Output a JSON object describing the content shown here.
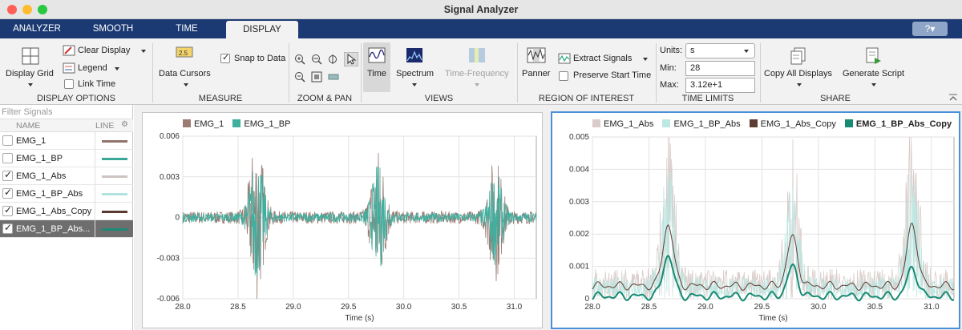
{
  "window": {
    "title": "Signal Analyzer"
  },
  "tabs": [
    {
      "label": "ANALYZER"
    },
    {
      "label": "SMOOTH"
    },
    {
      "label": "TIME"
    },
    {
      "label": "DISPLAY",
      "active": true
    }
  ],
  "help": {
    "icon": "question-icon"
  },
  "ribbon": {
    "display_options": {
      "label": "DISPLAY OPTIONS",
      "display_grid": "Display Grid",
      "clear_display": "Clear Display",
      "legend": "Legend",
      "link_time": "Link Time"
    },
    "measure": {
      "label": "MEASURE",
      "data_cursors": "Data Cursors",
      "snap_to_data": "Snap to Data",
      "cursor_icon_text": "2.5"
    },
    "zoom_pan": {
      "label": "ZOOM & PAN"
    },
    "views": {
      "label": "VIEWS",
      "time": "Time",
      "spectrum": "Spectrum",
      "time_frequency": "Time-Frequency"
    },
    "roi": {
      "label": "REGION OF INTEREST",
      "panner": "Panner",
      "extract_signals": "Extract Signals",
      "preserve_start_time": "Preserve Start Time"
    },
    "time_limits": {
      "label": "TIME LIMITS",
      "units_label": "Units:",
      "units_value": "s",
      "min_label": "Min:",
      "min_value": "28",
      "max_label": "Max:",
      "max_value": "3.12e+1"
    },
    "share": {
      "label": "SHARE",
      "copy_all_displays": "Copy All Displays",
      "generate_script": "Generate Script"
    }
  },
  "signals_table": {
    "filter_placeholder": "Filter Signals",
    "headers": {
      "name": "NAME",
      "line": "LINE"
    },
    "rows": [
      {
        "name": "EMG_1",
        "checked": false,
        "color": "#8f726c"
      },
      {
        "name": "EMG_1_BP",
        "checked": false,
        "color": "#3aa898"
      },
      {
        "name": "EMG_1_Abs",
        "checked": true,
        "color": "#cdc4c2"
      },
      {
        "name": "EMG_1_BP_Abs",
        "checked": true,
        "color": "#b3e3df"
      },
      {
        "name": "EMG_1_Abs_Copy",
        "checked": true,
        "color": "#5b3a31"
      },
      {
        "name": "EMG_1_BP_Abs...",
        "checked": true,
        "color": "#1e8a76",
        "selected": true
      }
    ]
  },
  "colors": {
    "emg1": "#9c7b74",
    "emg1_bp": "#3fb0a0",
    "abs": "#d9ccc9",
    "bp_abs": "#bde7e2",
    "abs_copy": "#5e3d35",
    "bp_abs_copy": "#178a73",
    "selected_border": "#4a90d9"
  },
  "chart_data": [
    {
      "type": "line",
      "legend": [
        "EMG_1",
        "EMG_1_BP"
      ],
      "xlabel": "Time (s)",
      "xlim": [
        28.0,
        31.2
      ],
      "ylim": [
        -0.006,
        0.006
      ],
      "xticks": [
        "28.0",
        "28.5",
        "29.0",
        "29.5",
        "30.0",
        "30.5",
        "31.0"
      ],
      "yticks": [
        "0.006",
        "0.003",
        "0",
        "-0.003",
        "-0.006"
      ],
      "bursts": [
        {
          "t": 28.67,
          "amp": 0.0058
        },
        {
          "t": 29.77,
          "amp": 0.0048
        },
        {
          "t": 30.83,
          "amp": 0.0042
        }
      ],
      "baseline_amp": 0.0004
    },
    {
      "type": "line",
      "legend": [
        "EMG_1_Abs",
        "EMG_1_BP_Abs",
        "EMG_1_Abs_Copy",
        "EMG_1_BP_Abs_Copy"
      ],
      "xlabel": "Time (s)",
      "xlim": [
        28.0,
        31.2
      ],
      "ylim": [
        0,
        0.005
      ],
      "xticks": [
        "28.0",
        "28.5",
        "29.0",
        "29.5",
        "30.0",
        "30.5",
        "31.0"
      ],
      "yticks": [
        "0.005",
        "0.004",
        "0.003",
        "0.002",
        "0.001",
        "0"
      ],
      "abs_copy_peaks": [
        {
          "t": 28.67,
          "v": 0.0023
        },
        {
          "t": 29.77,
          "v": 0.0019
        },
        {
          "t": 30.83,
          "v": 0.0023
        }
      ],
      "bp_abs_copy_peaks": [
        {
          "t": 28.67,
          "v": 0.00135
        },
        {
          "t": 29.77,
          "v": 0.00098
        },
        {
          "t": 30.83,
          "v": 0.00095
        }
      ]
    }
  ]
}
